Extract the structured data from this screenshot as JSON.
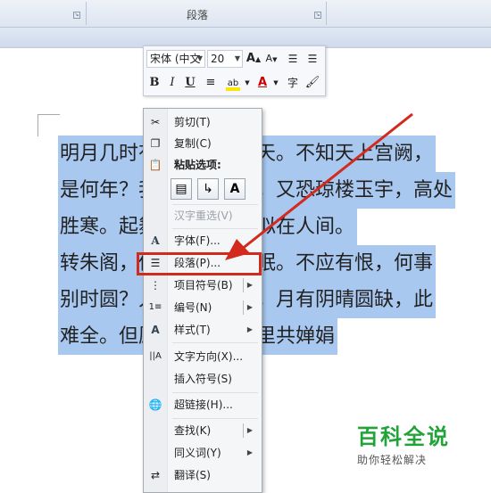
{
  "ribbon": {
    "group_label": "段落"
  },
  "document": {
    "lines": [
      "明月几时有？把酒问青天。不知天上宫阙，",
      "是何年？我欲乘风归去，又恐琼楼玉宇，高处",
      "胜寒。起舞弄清影，何似在人间。",
      "转朱阁，低绮户，照无眠。不应有恨，何事",
      "别时圆？人有悲欢离合，月有阴晴圆缺，此",
      "难全。但愿人长久，千里共婵娟"
    ]
  },
  "mini_toolbar": {
    "font_name": "宋体 (中文",
    "font_size": "20",
    "grow_font": "A",
    "shrink_font": "A",
    "bold": "B",
    "italic": "I",
    "underline": "U",
    "font_color": "A"
  },
  "context_menu": {
    "items": [
      {
        "label": "剪切(T)",
        "icon": "scissors-icon"
      },
      {
        "label": "复制(C)",
        "icon": "copy-icon"
      },
      {
        "label": "粘贴选项:",
        "icon": "paste-icon"
      },
      {
        "label": "汉字重选(V)",
        "icon": ""
      },
      {
        "label": "字体(F)...",
        "icon": "font-icon"
      },
      {
        "label": "段落(P)...",
        "icon": "paragraph-icon"
      },
      {
        "label": "项目符号(B)",
        "icon": "bullets-icon"
      },
      {
        "label": "编号(N)",
        "icon": "numbering-icon"
      },
      {
        "label": "样式(T)",
        "icon": "styles-icon"
      },
      {
        "label": "文字方向(X)...",
        "icon": "text-direction-icon"
      },
      {
        "label": "插入符号(S)",
        "icon": ""
      },
      {
        "label": "超链接(H)...",
        "icon": "hyperlink-icon"
      },
      {
        "label": "查找(K)",
        "icon": ""
      },
      {
        "label": "同义词(Y)",
        "icon": ""
      },
      {
        "label": "翻译(S)",
        "icon": "translate-icon"
      }
    ],
    "paste_options": [
      "keep-source-formatting",
      "merge-formatting",
      "keep-text-only"
    ]
  },
  "watermark": {
    "title": "百科全说",
    "subtitle": "助你轻松解决"
  },
  "colors": {
    "selection": "#a8c8f0",
    "highlight_box": "#d32a1e",
    "arrow": "#d32a1e",
    "watermark": "#22a33a"
  }
}
